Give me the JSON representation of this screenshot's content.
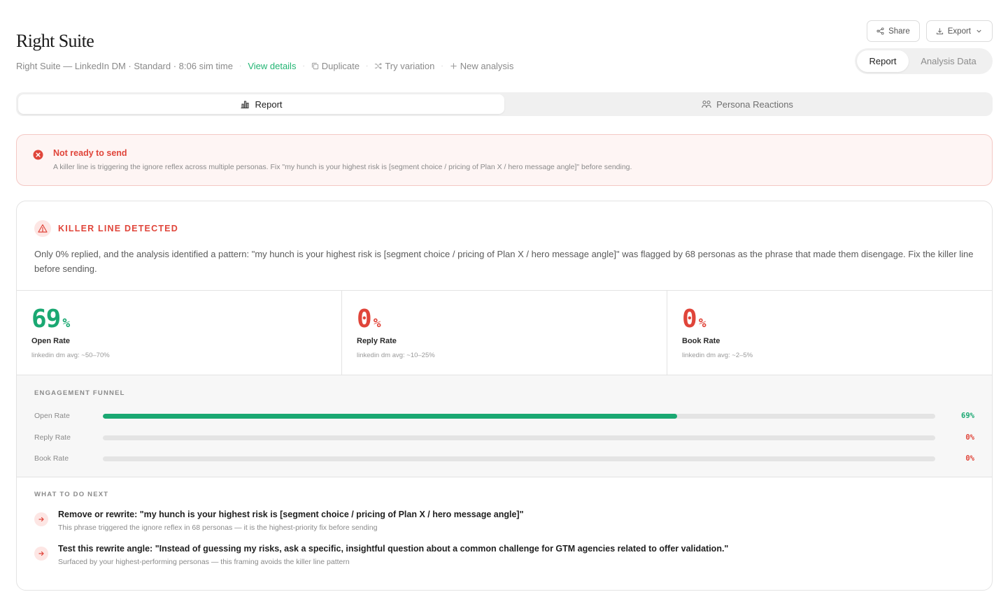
{
  "header": {
    "title": "Right Suite",
    "meta": "Right Suite — LinkedIn DM · Standard · 8:06 sim time",
    "view_details": "View details",
    "duplicate": "Duplicate",
    "try_variation": "Try variation",
    "new_analysis": "New analysis"
  },
  "top_actions": {
    "share": "Share",
    "export": "Export"
  },
  "view_toggle": {
    "report": "Report",
    "analysis_data": "Analysis Data",
    "selected": "Report"
  },
  "tabs": [
    {
      "label": "Report",
      "icon": "bar-chart-icon",
      "active": true
    },
    {
      "label": "Persona Reactions",
      "icon": "users-icon",
      "active": false
    }
  ],
  "alert": {
    "title": "Not ready to send",
    "text": "A killer line is triggering the ignore reflex across multiple personas. Fix \"my hunch is your highest risk is [segment choice / pricing of Plan X / hero message angle]\" before sending."
  },
  "killer": {
    "title": "KILLER LINE DETECTED",
    "body": "Only 0% replied, and the analysis identified a pattern: \"my hunch is your highest risk is [segment choice / pricing of Plan X / hero message angle]\" was flagged by 68 personas as the phrase that made them disengage. Fix the killer line before sending."
  },
  "metrics": [
    {
      "value": "69",
      "unit": "%",
      "label": "Open Rate",
      "avg": "linkedin dm avg: ~50–70%",
      "status": "good"
    },
    {
      "value": "0",
      "unit": "%",
      "label": "Reply Rate",
      "avg": "linkedin dm avg: ~10–25%",
      "status": "bad"
    },
    {
      "value": "0",
      "unit": "%",
      "label": "Book Rate",
      "avg": "linkedin dm avg: ~2–5%",
      "status": "bad"
    }
  ],
  "funnel": {
    "title": "ENGAGEMENT FUNNEL",
    "rows": [
      {
        "label": "Open Rate",
        "value": 69,
        "display": "69%"
      },
      {
        "label": "Reply Rate",
        "value": 0,
        "display": "0%"
      },
      {
        "label": "Book Rate",
        "value": 0,
        "display": "0%"
      }
    ]
  },
  "next_steps": {
    "title": "WHAT TO DO NEXT",
    "items": [
      {
        "title": "Remove or rewrite: \"my hunch is your highest risk is [segment choice / pricing of Plan X / hero message angle]\"",
        "sub": "This phrase triggered the ignore reflex in 68 personas — it is the highest-priority fix before sending"
      },
      {
        "title": "Test this rewrite angle: \"Instead of guessing my risks, ask a specific, insightful question about a common challenge for GTM agencies related to offer validation.\"",
        "sub": "Surfaced by your highest-performing personas — this framing avoids the killer line pattern"
      }
    ]
  },
  "colors": {
    "accent_green": "#1aa872",
    "danger_red": "#e0453a",
    "link_green": "#22b573"
  }
}
